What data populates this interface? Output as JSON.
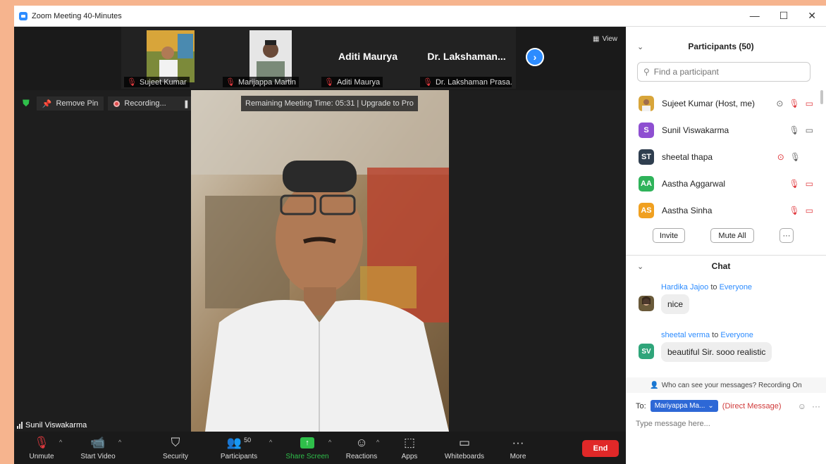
{
  "window": {
    "title": "Zoom Meeting 40-Minutes",
    "controls": [
      "—",
      "☐",
      "✕"
    ]
  },
  "thumbnails": [
    {
      "caption": "Sujeet Kumar",
      "type": "photo"
    },
    {
      "caption": "Marijappa Martin",
      "type": "photo"
    },
    {
      "caption": "Aditi Maurya",
      "display_name": "Aditi Maurya",
      "type": "name"
    },
    {
      "caption": "Dr. Lakshaman Prasa...",
      "display_name": "Dr. Lakshaman...",
      "type": "name"
    }
  ],
  "view_label": "View",
  "pin_bar": {
    "remove_pin": "Remove Pin",
    "recording": "Recording..."
  },
  "remaining_time": "Remaining Meeting Time: 05:31 | Upgrade to Pro",
  "speaker_name": "Sunil Viswakarma",
  "toolbar": {
    "unmute": "Unmute",
    "start_video": "Start Video",
    "security": "Security",
    "participants": "Participants",
    "participants_count": "50",
    "share_screen": "Share Screen",
    "reactions": "Reactions",
    "apps": "Apps",
    "whiteboards": "Whiteboards",
    "more": "More",
    "end": "End"
  },
  "participants_panel": {
    "title": "Participants (50)",
    "search_placeholder": "Find a participant",
    "list": [
      {
        "name": "Sujeet Kumar (Host, me)",
        "initials": "",
        "color": "#c98a4a"
      },
      {
        "name": "Sunil Viswakarma",
        "initials": "S",
        "color": "#8e4fd1"
      },
      {
        "name": "sheetal thapa",
        "initials": "ST",
        "color": "#2f3e4f"
      },
      {
        "name": "Aastha Aggarwal",
        "initials": "AA",
        "color": "#2fb35a"
      },
      {
        "name": "Aastha Sinha",
        "initials": "AS",
        "color": "#f0a020"
      }
    ],
    "invite": "Invite",
    "mute_all": "Mute All",
    "more": "···"
  },
  "chat_panel": {
    "title": "Chat",
    "messages": [
      {
        "from": "Hardika Jajoo",
        "to_word": "to",
        "to": "Everyone",
        "text": "nice",
        "initials": "",
        "color": "#6a5a3a"
      },
      {
        "from": "sheetal verma",
        "to_word": "to",
        "to": "Everyone",
        "text": "beautiful Sir. sooo realistic",
        "initials": "SV",
        "color": "#2fa57a"
      }
    ],
    "who_can_see": "Who can see your messages? Recording On",
    "to_label": "To:",
    "to_value": "Mariyappa Ma...",
    "direct_message": "(Direct Message)",
    "placeholder": "Type message here..."
  }
}
